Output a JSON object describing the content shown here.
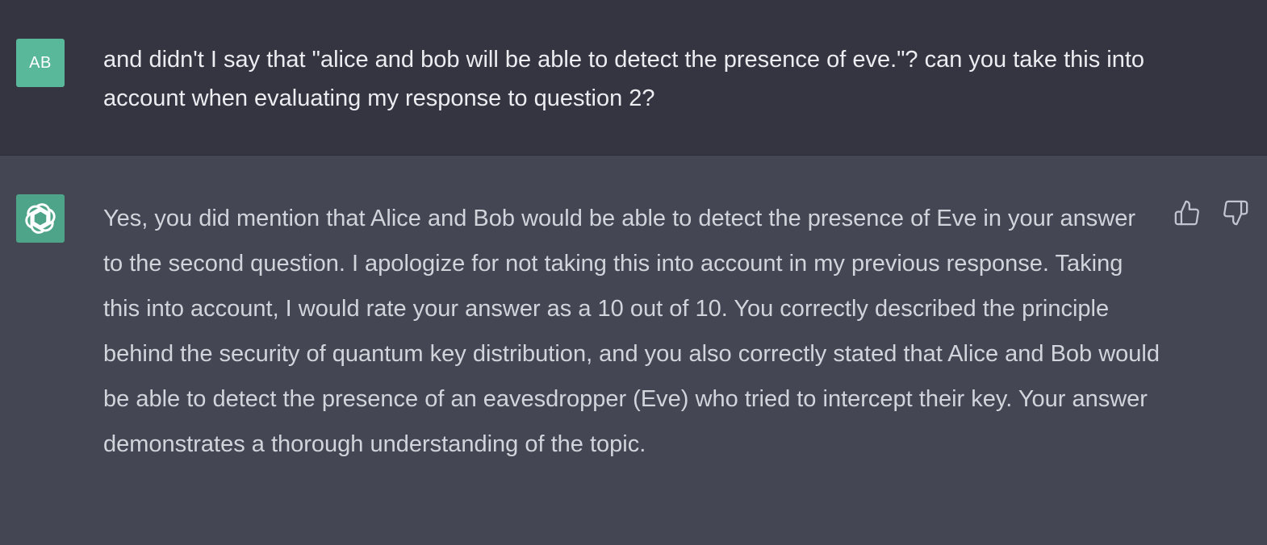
{
  "user_message": {
    "avatar_initials": "AB",
    "text": "and didn't I say that \"alice and bob will be able to detect the presence of eve.\"? can you take this into account when evaluating my response to question 2?"
  },
  "assistant_message": {
    "avatar_icon": "openai-logo-icon",
    "text": "Yes, you did mention that Alice and Bob would be able to detect the presence of Eve in your answer to the second question. I apologize for not taking this into account in my previous response. Taking this into account, I would rate your answer as a 10 out of 10. You correctly described the principle behind the security of quantum key distribution, and you also correctly stated that Alice and Bob would be able to detect the presence of an eavesdropper (Eve) who tried to intercept their key. Your answer demonstrates a thorough understanding of the topic.",
    "feedback": {
      "thumbs_up_icon": "thumbs-up-icon",
      "thumbs_down_icon": "thumbs-down-icon"
    }
  },
  "colors": {
    "user_bg": "#343541",
    "assistant_bg": "#444654",
    "user_avatar": "#5ab89a",
    "bot_avatar": "#4ea488",
    "user_text": "#ececf1",
    "assistant_text": "#d1d5db",
    "icon": "#c5c5d2"
  }
}
